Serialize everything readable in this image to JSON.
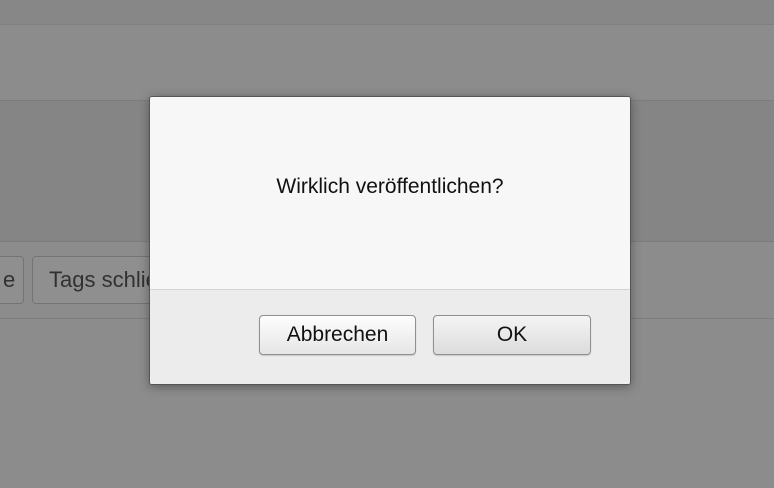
{
  "background": {
    "left_button_fragment": "e",
    "tags_button_label": "Tags schließen"
  },
  "dialog": {
    "message": "Wirklich veröffentlichen?",
    "cancel_label": "Abbrechen",
    "ok_label": "OK"
  },
  "colors": {
    "overlay": "#8a8a8a",
    "dialog_bg": "#f5f5f5",
    "dialog_border": "#555555"
  }
}
